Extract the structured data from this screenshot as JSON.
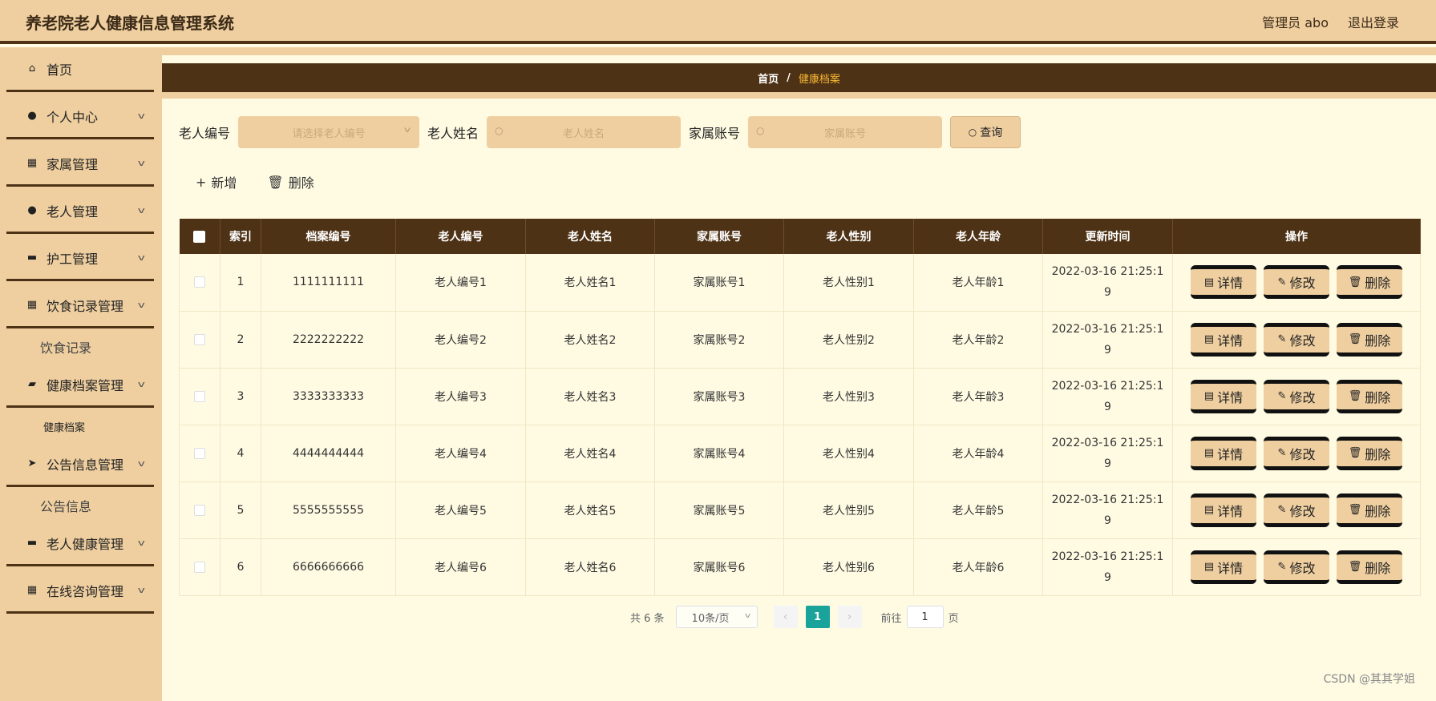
{
  "header": {
    "title": "养老院老人健康信息管理系统",
    "user": "管理员 abo",
    "logout": "退出登录"
  },
  "sidebar": {
    "items": [
      {
        "label": "首页",
        "icon": "home-icon",
        "glyph": "⌂",
        "expanded": false
      },
      {
        "label": "个人中心",
        "icon": "user-icon",
        "glyph": "●",
        "expanded": false
      },
      {
        "label": "家属管理",
        "icon": "grid-icon",
        "glyph": "▦",
        "expanded": false
      },
      {
        "label": "老人管理",
        "icon": "user-icon",
        "glyph": "●",
        "expanded": false
      },
      {
        "label": "护工管理",
        "icon": "chat-icon",
        "glyph": "▬",
        "expanded": false
      },
      {
        "label": "饮食记录管理",
        "icon": "grid-icon",
        "glyph": "▦",
        "expanded": true,
        "sub": "饮食记录"
      },
      {
        "label": "健康档案管理",
        "icon": "folder-icon",
        "glyph": "▰",
        "expanded": true,
        "sub": "健康档案"
      },
      {
        "label": "公告信息管理",
        "icon": "send-icon",
        "glyph": "➤",
        "expanded": true,
        "sub": "公告信息"
      },
      {
        "label": "老人健康管理",
        "icon": "briefcase-icon",
        "glyph": "▬",
        "expanded": false
      },
      {
        "label": "在线咨询管理",
        "icon": "grid-icon",
        "glyph": "▦",
        "expanded": false
      }
    ]
  },
  "breadcrumb": {
    "home": "首页",
    "separator": "/",
    "current": "健康档案"
  },
  "filters": {
    "elder_no_label": "老人编号",
    "elder_no_placeholder": "请选择老人编号",
    "elder_name_label": "老人姓名",
    "elder_name_placeholder": "老人姓名",
    "family_label": "家属账号",
    "family_placeholder": "家属账号",
    "search": "查询"
  },
  "actions": {
    "add": "新增",
    "delete": "删除"
  },
  "table": {
    "headers": [
      "索引",
      "档案编号",
      "老人编号",
      "老人姓名",
      "家属账号",
      "老人性别",
      "老人年龄",
      "更新时间",
      "操作"
    ],
    "rows": [
      [
        "1",
        "1111111111",
        "老人编号1",
        "老人姓名1",
        "家属账号1",
        "老人性别1",
        "老人年龄1",
        "2022-03-16 21:25:19"
      ],
      [
        "2",
        "2222222222",
        "老人编号2",
        "老人姓名2",
        "家属账号2",
        "老人性别2",
        "老人年龄2",
        "2022-03-16 21:25:19"
      ],
      [
        "3",
        "3333333333",
        "老人编号3",
        "老人姓名3",
        "家属账号3",
        "老人性别3",
        "老人年龄3",
        "2022-03-16 21:25:19"
      ],
      [
        "4",
        "4444444444",
        "老人编号4",
        "老人姓名4",
        "家属账号4",
        "老人性别4",
        "老人年龄4",
        "2022-03-16 21:25:19"
      ],
      [
        "5",
        "5555555555",
        "老人编号5",
        "老人姓名5",
        "家属账号5",
        "老人性别5",
        "老人年龄5",
        "2022-03-16 21:25:19"
      ],
      [
        "6",
        "6666666666",
        "老人编号6",
        "老人姓名6",
        "家属账号6",
        "老人性别6",
        "老人年龄6",
        "2022-03-16 21:25:19"
      ]
    ],
    "ops": {
      "detail": "详情",
      "edit": "修改",
      "delete": "删除"
    }
  },
  "pager": {
    "total": "共 6 条",
    "page_size": "10条/页",
    "current": "1",
    "goto": "前往",
    "page_input": "1",
    "unit": "页"
  },
  "watermark": "CSDN @其其学姐",
  "colors": {
    "header_bg": "#efcfa0",
    "dark_brown": "#4e3215",
    "content_bg": "#fffbe3",
    "active_crumb": "#f7b733",
    "page_active": "#19a39b"
  }
}
